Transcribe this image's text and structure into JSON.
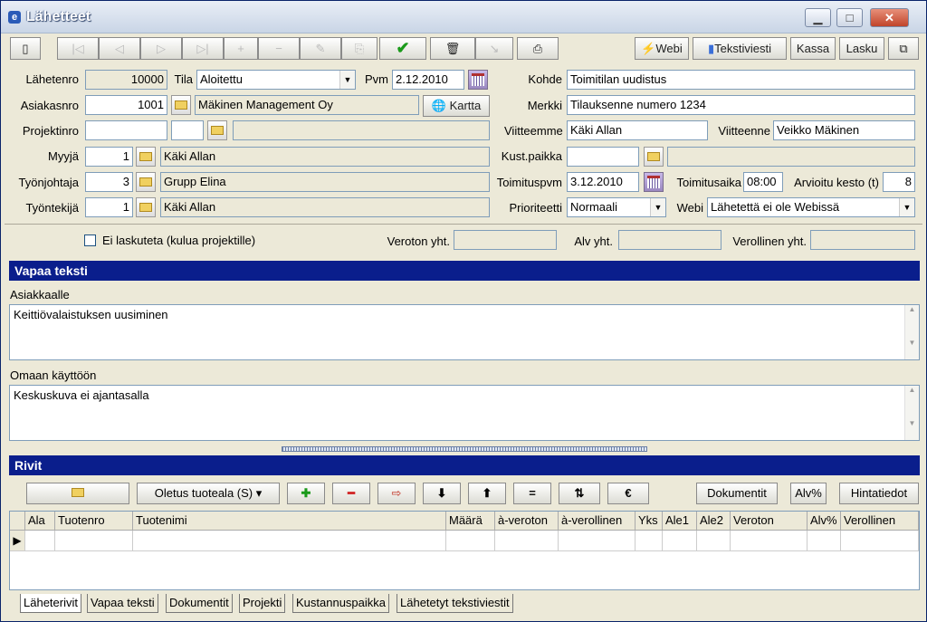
{
  "window": {
    "title": "Lähetteet"
  },
  "toolbar": {
    "webi": "Webi",
    "tekstiviesti": "Tekstiviesti",
    "kassa": "Kassa",
    "lasku": "Lasku"
  },
  "form": {
    "lahetenro_label": "Lähetenro",
    "lahetenro": "10000",
    "tila_label": "Tila",
    "tila": "Aloitettu",
    "pvm_label": "Pvm",
    "pvm": "2.12.2010",
    "kohde_label": "Kohde",
    "kohde": "Toimitilan uudistus",
    "asiakasnro_label": "Asiakasnro",
    "asiakasnro": "1001",
    "asiakas_nimi": "Mäkinen Management Oy",
    "kartta": "Kartta",
    "merkki_label": "Merkki",
    "merkki": "Tilauksenne numero 1234",
    "projektinro_label": "Projektinro",
    "viitteemme_label": "Viitteemme",
    "viitteemme": "Käki Allan",
    "viitteenne_label": "Viitteenne",
    "viitteenne": "Veikko Mäkinen",
    "myyja_label": "Myyjä",
    "myyja_nro": "1",
    "myyja": "Käki Allan",
    "kustpaikka_label": "Kust.paikka",
    "tyonjohtaja_label": "Työnjohtaja",
    "tyonjohtaja_nro": "3",
    "tyonjohtaja": "Grupp Elina",
    "toimituspvm_label": "Toimituspvm",
    "toimituspvm": "3.12.2010",
    "toimitusaika_label": "Toimitusaika",
    "toimitusaika": "08:00",
    "kesto_label": "Arvioitu kesto (t)",
    "kesto": "8",
    "tyontekija_label": "Työntekijä",
    "tyontekija_nro": "1",
    "tyontekija": "Käki Allan",
    "prioriteetti_label": "Prioriteetti",
    "prioriteetti": "Normaali",
    "webi_label": "Webi",
    "webi": "Lähetettä ei ole Webissä",
    "ei_laskuteta": "Ei laskuteta (kulua projektille)",
    "veroton_label": "Veroton yht.",
    "alv_label": "Alv yht.",
    "verollinen_label": "Verollinen yht."
  },
  "free_text": {
    "header": "Vapaa teksti",
    "asiakkaalle_label": "Asiakkaalle",
    "asiakkaalle": "Keittiövalaistuksen uusiminen",
    "omaan_label": "Omaan käyttöön",
    "omaan": "Keskuskuva ei ajantasalla"
  },
  "rows": {
    "header": "Rivit",
    "tuoteala": "Oletus tuoteala (S)",
    "dokumentit": "Dokumentit",
    "alv": "Alv%",
    "hintatiedot": "Hintatiedot",
    "columns": [
      "Ala",
      "Tuotenro",
      "Tuotenimi",
      "Määrä",
      "à-veroton",
      "à-verollinen",
      "Yks",
      "Ale1",
      "Ale2",
      "Veroton",
      "Alv%",
      "Verollinen"
    ]
  },
  "tabs": [
    "Läheterivit",
    "Vapaa teksti",
    "Dokumentit",
    "Projekti",
    "Kustannuspaikka",
    "Lähetetyt tekstiviestit"
  ]
}
